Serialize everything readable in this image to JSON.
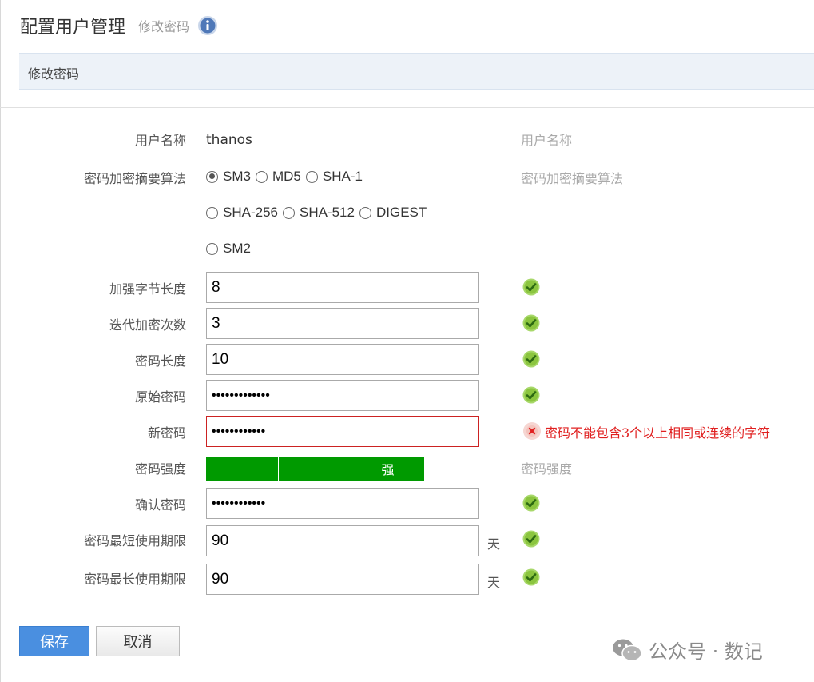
{
  "header": {
    "title": "配置用户管理",
    "subtitle": "修改密码",
    "info_icon": "info-circle-icon"
  },
  "section": {
    "title": "修改密码"
  },
  "form": {
    "username": {
      "label": "用户名称",
      "value": "thanos",
      "hint": "用户名称"
    },
    "algorithm": {
      "label": "密码加密摘要算法",
      "hint": "密码加密摘要算法",
      "options": [
        "SM3",
        "MD5",
        "SHA-1",
        "SHA-256",
        "SHA-512",
        "DIGEST",
        "SM2"
      ],
      "selected": "SM3"
    },
    "salt_length": {
      "label": "加强字节长度",
      "value": "8",
      "status": "ok"
    },
    "iterations": {
      "label": "迭代加密次数",
      "value": "3",
      "status": "ok"
    },
    "password_length": {
      "label": "密码长度",
      "value": "10",
      "status": "ok"
    },
    "old_password": {
      "label": "原始密码",
      "value": "•••••••••••••",
      "status": "ok"
    },
    "new_password": {
      "label": "新密码",
      "value": "••••••••••••",
      "status": "error",
      "error": "密码不能包含3个以上相同或连续的字符"
    },
    "strength": {
      "label": "密码强度",
      "text": "强",
      "hint": "密码强度",
      "level": "3 of 3"
    },
    "confirm_password": {
      "label": "确认密码",
      "value": "••••••••••••",
      "status": "ok"
    },
    "min_age": {
      "label": "密码最短使用期限",
      "value": "90",
      "unit": "天",
      "status": "ok"
    },
    "max_age": {
      "label": "密码最长使用期限",
      "value": "90",
      "unit": "天",
      "status": "ok"
    }
  },
  "buttons": {
    "save": "保存",
    "cancel": "取消"
  },
  "watermark": {
    "text": "公众号 · 数记",
    "icon": "wechat-icon"
  },
  "colors": {
    "accent": "#4a8fe0",
    "strength": "#009a00",
    "error": "#e02020",
    "ok": "#8bc53f"
  }
}
